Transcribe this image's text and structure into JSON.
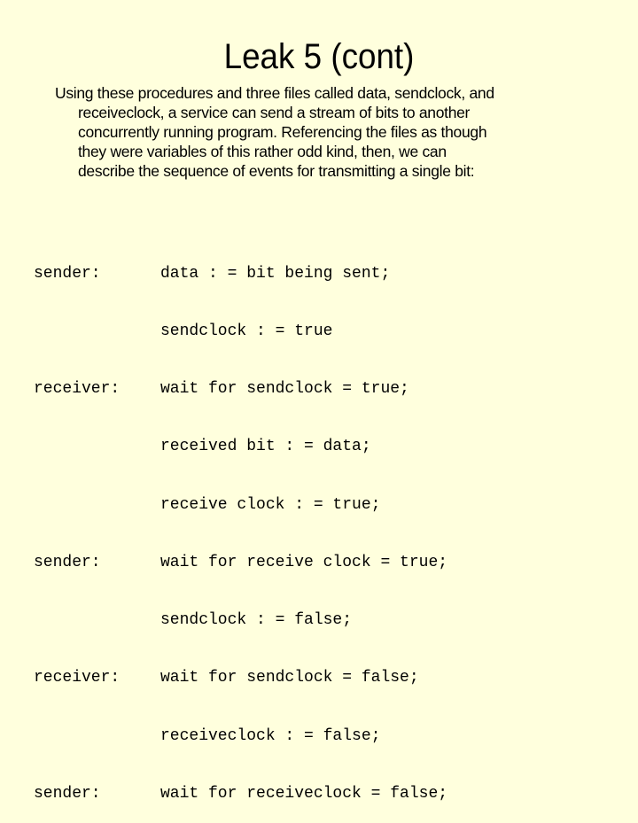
{
  "slide": {
    "title": "Leak 5 (cont)",
    "paragraph": {
      "first_line": "Using these procedures and three files called data, sendclock, and",
      "continuation_lines": [
        "receiveclock, a service can send a stream of bits to another",
        "concurrently running program. Referencing the files as though",
        "they were variables of this rather odd kind, then, we can",
        "describe the sequence of events for transmitting a single bit:"
      ]
    },
    "protocol": [
      {
        "role": "sender:",
        "statement": "data : = bit being sent;"
      },
      {
        "role": "",
        "statement": "sendclock : = true"
      },
      {
        "role": "receiver:",
        "statement": "wait for sendclock = true;"
      },
      {
        "role": "",
        "statement": "received bit : = data;"
      },
      {
        "role": "",
        "statement": "receive clock : = true;"
      },
      {
        "role": "sender:",
        "statement": "wait for receive clock = true;"
      },
      {
        "role": "",
        "statement": "sendclock : = false;"
      },
      {
        "role": "receiver:",
        "statement": "wait for sendclock = false;"
      },
      {
        "role": "",
        "statement": "receiveclock : = false;"
      },
      {
        "role": "sender:",
        "statement": "wait for receiveclock = false;"
      }
    ]
  }
}
